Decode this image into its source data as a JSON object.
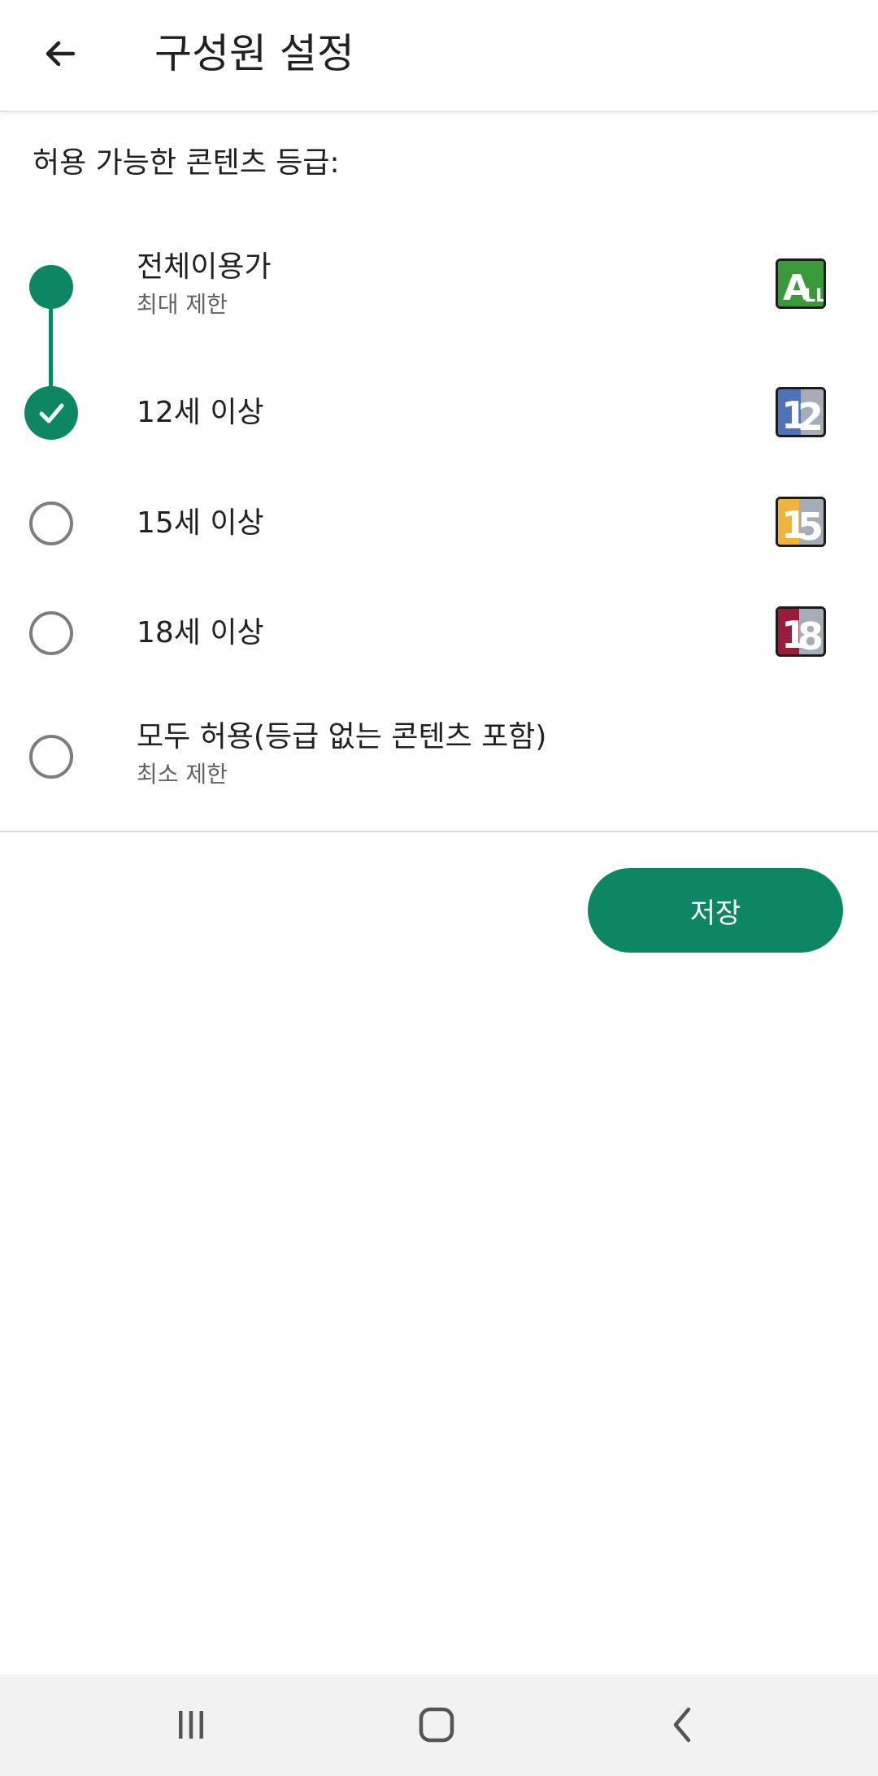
{
  "header": {
    "title": "구성원 설정"
  },
  "section": {
    "label": "허용 가능한 콘텐츠 등급:"
  },
  "options": [
    {
      "label": "전체이용가",
      "sublabel": "최대 제한",
      "badge": {
        "text": "ALL",
        "color": "#3a9a3a"
      },
      "state": "dot"
    },
    {
      "label": "12세 이상",
      "badge": {
        "text": "12",
        "color": "#4f73b8"
      },
      "state": "checked"
    },
    {
      "label": "15세 이상",
      "badge": {
        "text": "15",
        "color": "#f2b33d"
      },
      "state": "unselected"
    },
    {
      "label": "18세 이상",
      "badge": {
        "text": "18",
        "color": "#9b1b3b"
      },
      "state": "unselected"
    },
    {
      "label": "모두 허용(등급 없는 콘텐츠 포함)",
      "sublabel": "최소 제한",
      "state": "unselected"
    }
  ],
  "actions": {
    "save_label": "저장"
  },
  "colors": {
    "accent": "#0d8763",
    "radio_border": "#7d7d7d",
    "text_primary": "#202124",
    "text_secondary": "#5f6368"
  },
  "navbar": {
    "icons": [
      "recent-apps-icon",
      "home-icon",
      "back-nav-icon"
    ]
  }
}
